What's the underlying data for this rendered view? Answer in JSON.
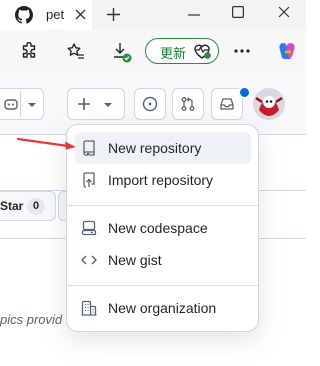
{
  "browser": {
    "tab_title": "pet",
    "update_button": "更新"
  },
  "page": {
    "star_label": "Star",
    "star_count": "0",
    "topics_fragment": "pics provid"
  },
  "menu": {
    "items": [
      {
        "label": "New repository",
        "icon": "repo-icon",
        "highlighted": true
      },
      {
        "label": "Import repository",
        "icon": "repo-push-icon"
      },
      {
        "label": "New codespace",
        "icon": "codespaces-icon"
      },
      {
        "label": "New gist",
        "icon": "code-icon"
      },
      {
        "label": "New organization",
        "icon": "organization-icon"
      }
    ]
  },
  "colors": {
    "highlight": "#eff2f5",
    "arrow": "#e5383b",
    "update_green": "#1a7f37",
    "notification_dot": "#0969da"
  }
}
